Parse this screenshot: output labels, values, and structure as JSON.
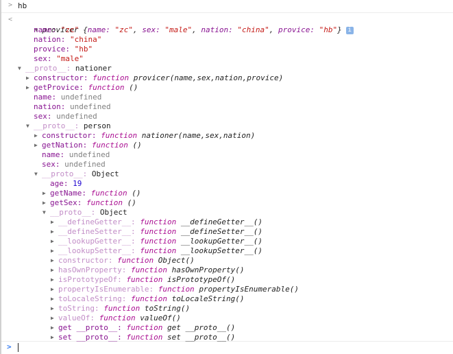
{
  "input": {
    "prompt_icon": "chevron-right-icon",
    "command": "hb"
  },
  "output": {
    "return_icon": "chevron-left-icon",
    "info_icon": "info-icon",
    "info_glyph": "i",
    "class_name": "provicer",
    "summary": [
      {
        "key": "name",
        "value": "\"zc\""
      },
      {
        "key": "sex",
        "value": "\"male\""
      },
      {
        "key": "nation",
        "value": "\"china\""
      },
      {
        "key": "provice",
        "value": "\"hb\""
      }
    ],
    "rows": [
      {
        "level": 1,
        "arrow": "none",
        "key": "name",
        "kstyle": "own",
        "vtype": "str",
        "value": "\"zc\""
      },
      {
        "level": 1,
        "arrow": "none",
        "key": "nation",
        "kstyle": "own",
        "vtype": "str",
        "value": "\"china\""
      },
      {
        "level": 1,
        "arrow": "none",
        "key": "provice",
        "kstyle": "own",
        "vtype": "str",
        "value": "\"hb\""
      },
      {
        "level": 1,
        "arrow": "none",
        "key": "sex",
        "kstyle": "own",
        "vtype": "str",
        "value": "\"male\""
      },
      {
        "level": 0,
        "arrow": "down",
        "key": "__proto__",
        "kstyle": "dim",
        "vtype": "plain",
        "value": "nationer"
      },
      {
        "level": 1,
        "arrow": "right",
        "key": "constructor",
        "kstyle": "own",
        "vtype": "fn",
        "value": "provicer(name,sex,nation,provice)"
      },
      {
        "level": 1,
        "arrow": "right",
        "key": "getProvice",
        "kstyle": "own",
        "vtype": "fn",
        "value": "()"
      },
      {
        "level": 1,
        "arrow": "none",
        "key": "name",
        "kstyle": "own",
        "vtype": "undef",
        "value": "undefined"
      },
      {
        "level": 1,
        "arrow": "none",
        "key": "nation",
        "kstyle": "own",
        "vtype": "undef",
        "value": "undefined"
      },
      {
        "level": 1,
        "arrow": "none",
        "key": "sex",
        "kstyle": "own",
        "vtype": "undef",
        "value": "undefined"
      },
      {
        "level": 1,
        "arrow": "down",
        "key": "__proto__",
        "kstyle": "dim",
        "vtype": "plain",
        "value": "person"
      },
      {
        "level": 2,
        "arrow": "right",
        "key": "constructor",
        "kstyle": "own",
        "vtype": "fn",
        "value": "nationer(name,sex,nation)"
      },
      {
        "level": 2,
        "arrow": "right",
        "key": "getNation",
        "kstyle": "own",
        "vtype": "fn",
        "value": "()"
      },
      {
        "level": 2,
        "arrow": "none",
        "key": "name",
        "kstyle": "own",
        "vtype": "undef",
        "value": "undefined"
      },
      {
        "level": 2,
        "arrow": "none",
        "key": "sex",
        "kstyle": "own",
        "vtype": "undef",
        "value": "undefined"
      },
      {
        "level": 2,
        "arrow": "down",
        "key": "__proto__",
        "kstyle": "dim",
        "vtype": "plain",
        "value": "Object"
      },
      {
        "level": 3,
        "arrow": "none",
        "key": "age",
        "kstyle": "own",
        "vtype": "num",
        "value": "19"
      },
      {
        "level": 3,
        "arrow": "right",
        "key": "getName",
        "kstyle": "own",
        "vtype": "fn",
        "value": "()"
      },
      {
        "level": 3,
        "arrow": "right",
        "key": "getSex",
        "kstyle": "own",
        "vtype": "fn",
        "value": "()"
      },
      {
        "level": 3,
        "arrow": "down",
        "key": "__proto__",
        "kstyle": "dim",
        "vtype": "plain",
        "value": "Object"
      },
      {
        "level": 4,
        "arrow": "right",
        "key": "__defineGetter__",
        "kstyle": "dim",
        "vtype": "fn",
        "value": "__defineGetter__()"
      },
      {
        "level": 4,
        "arrow": "right",
        "key": "__defineSetter__",
        "kstyle": "dim",
        "vtype": "fn",
        "value": "__defineSetter__()"
      },
      {
        "level": 4,
        "arrow": "right",
        "key": "__lookupGetter__",
        "kstyle": "dim",
        "vtype": "fn",
        "value": "__lookupGetter__()"
      },
      {
        "level": 4,
        "arrow": "right",
        "key": "__lookupSetter__",
        "kstyle": "dim",
        "vtype": "fn",
        "value": "__lookupSetter__()"
      },
      {
        "level": 4,
        "arrow": "right",
        "key": "constructor",
        "kstyle": "dim",
        "vtype": "fn",
        "value": "Object()"
      },
      {
        "level": 4,
        "arrow": "right",
        "key": "hasOwnProperty",
        "kstyle": "dim",
        "vtype": "fn",
        "value": "hasOwnProperty()"
      },
      {
        "level": 4,
        "arrow": "right",
        "key": "isPrototypeOf",
        "kstyle": "dim",
        "vtype": "fn",
        "value": "isPrototypeOf()"
      },
      {
        "level": 4,
        "arrow": "right",
        "key": "propertyIsEnumerable",
        "kstyle": "dim",
        "vtype": "fn",
        "value": "propertyIsEnumerable()"
      },
      {
        "level": 4,
        "arrow": "right",
        "key": "toLocaleString",
        "kstyle": "dim",
        "vtype": "fn",
        "value": "toLocaleString()"
      },
      {
        "level": 4,
        "arrow": "right",
        "key": "toString",
        "kstyle": "dim",
        "vtype": "fn",
        "value": "toString()"
      },
      {
        "level": 4,
        "arrow": "right",
        "key": "valueOf",
        "kstyle": "dim",
        "vtype": "fn",
        "value": "valueOf()"
      },
      {
        "level": 4,
        "arrow": "right",
        "key": "get __proto__",
        "kstyle": "own",
        "vtype": "fn",
        "value": "get __proto__()"
      },
      {
        "level": 4,
        "arrow": "right",
        "key": "set __proto__",
        "kstyle": "own",
        "vtype": "fn",
        "value": "set __proto__()"
      }
    ],
    "function_keyword": "function"
  },
  "console_prompt": {
    "icon": "chevron-right-icon",
    "value": ""
  },
  "colors": {
    "key": "#881391",
    "string": "#c41a16",
    "number": "#1c00cf",
    "function_keyword": "#aa0d91",
    "prompt": "#367cf1"
  }
}
